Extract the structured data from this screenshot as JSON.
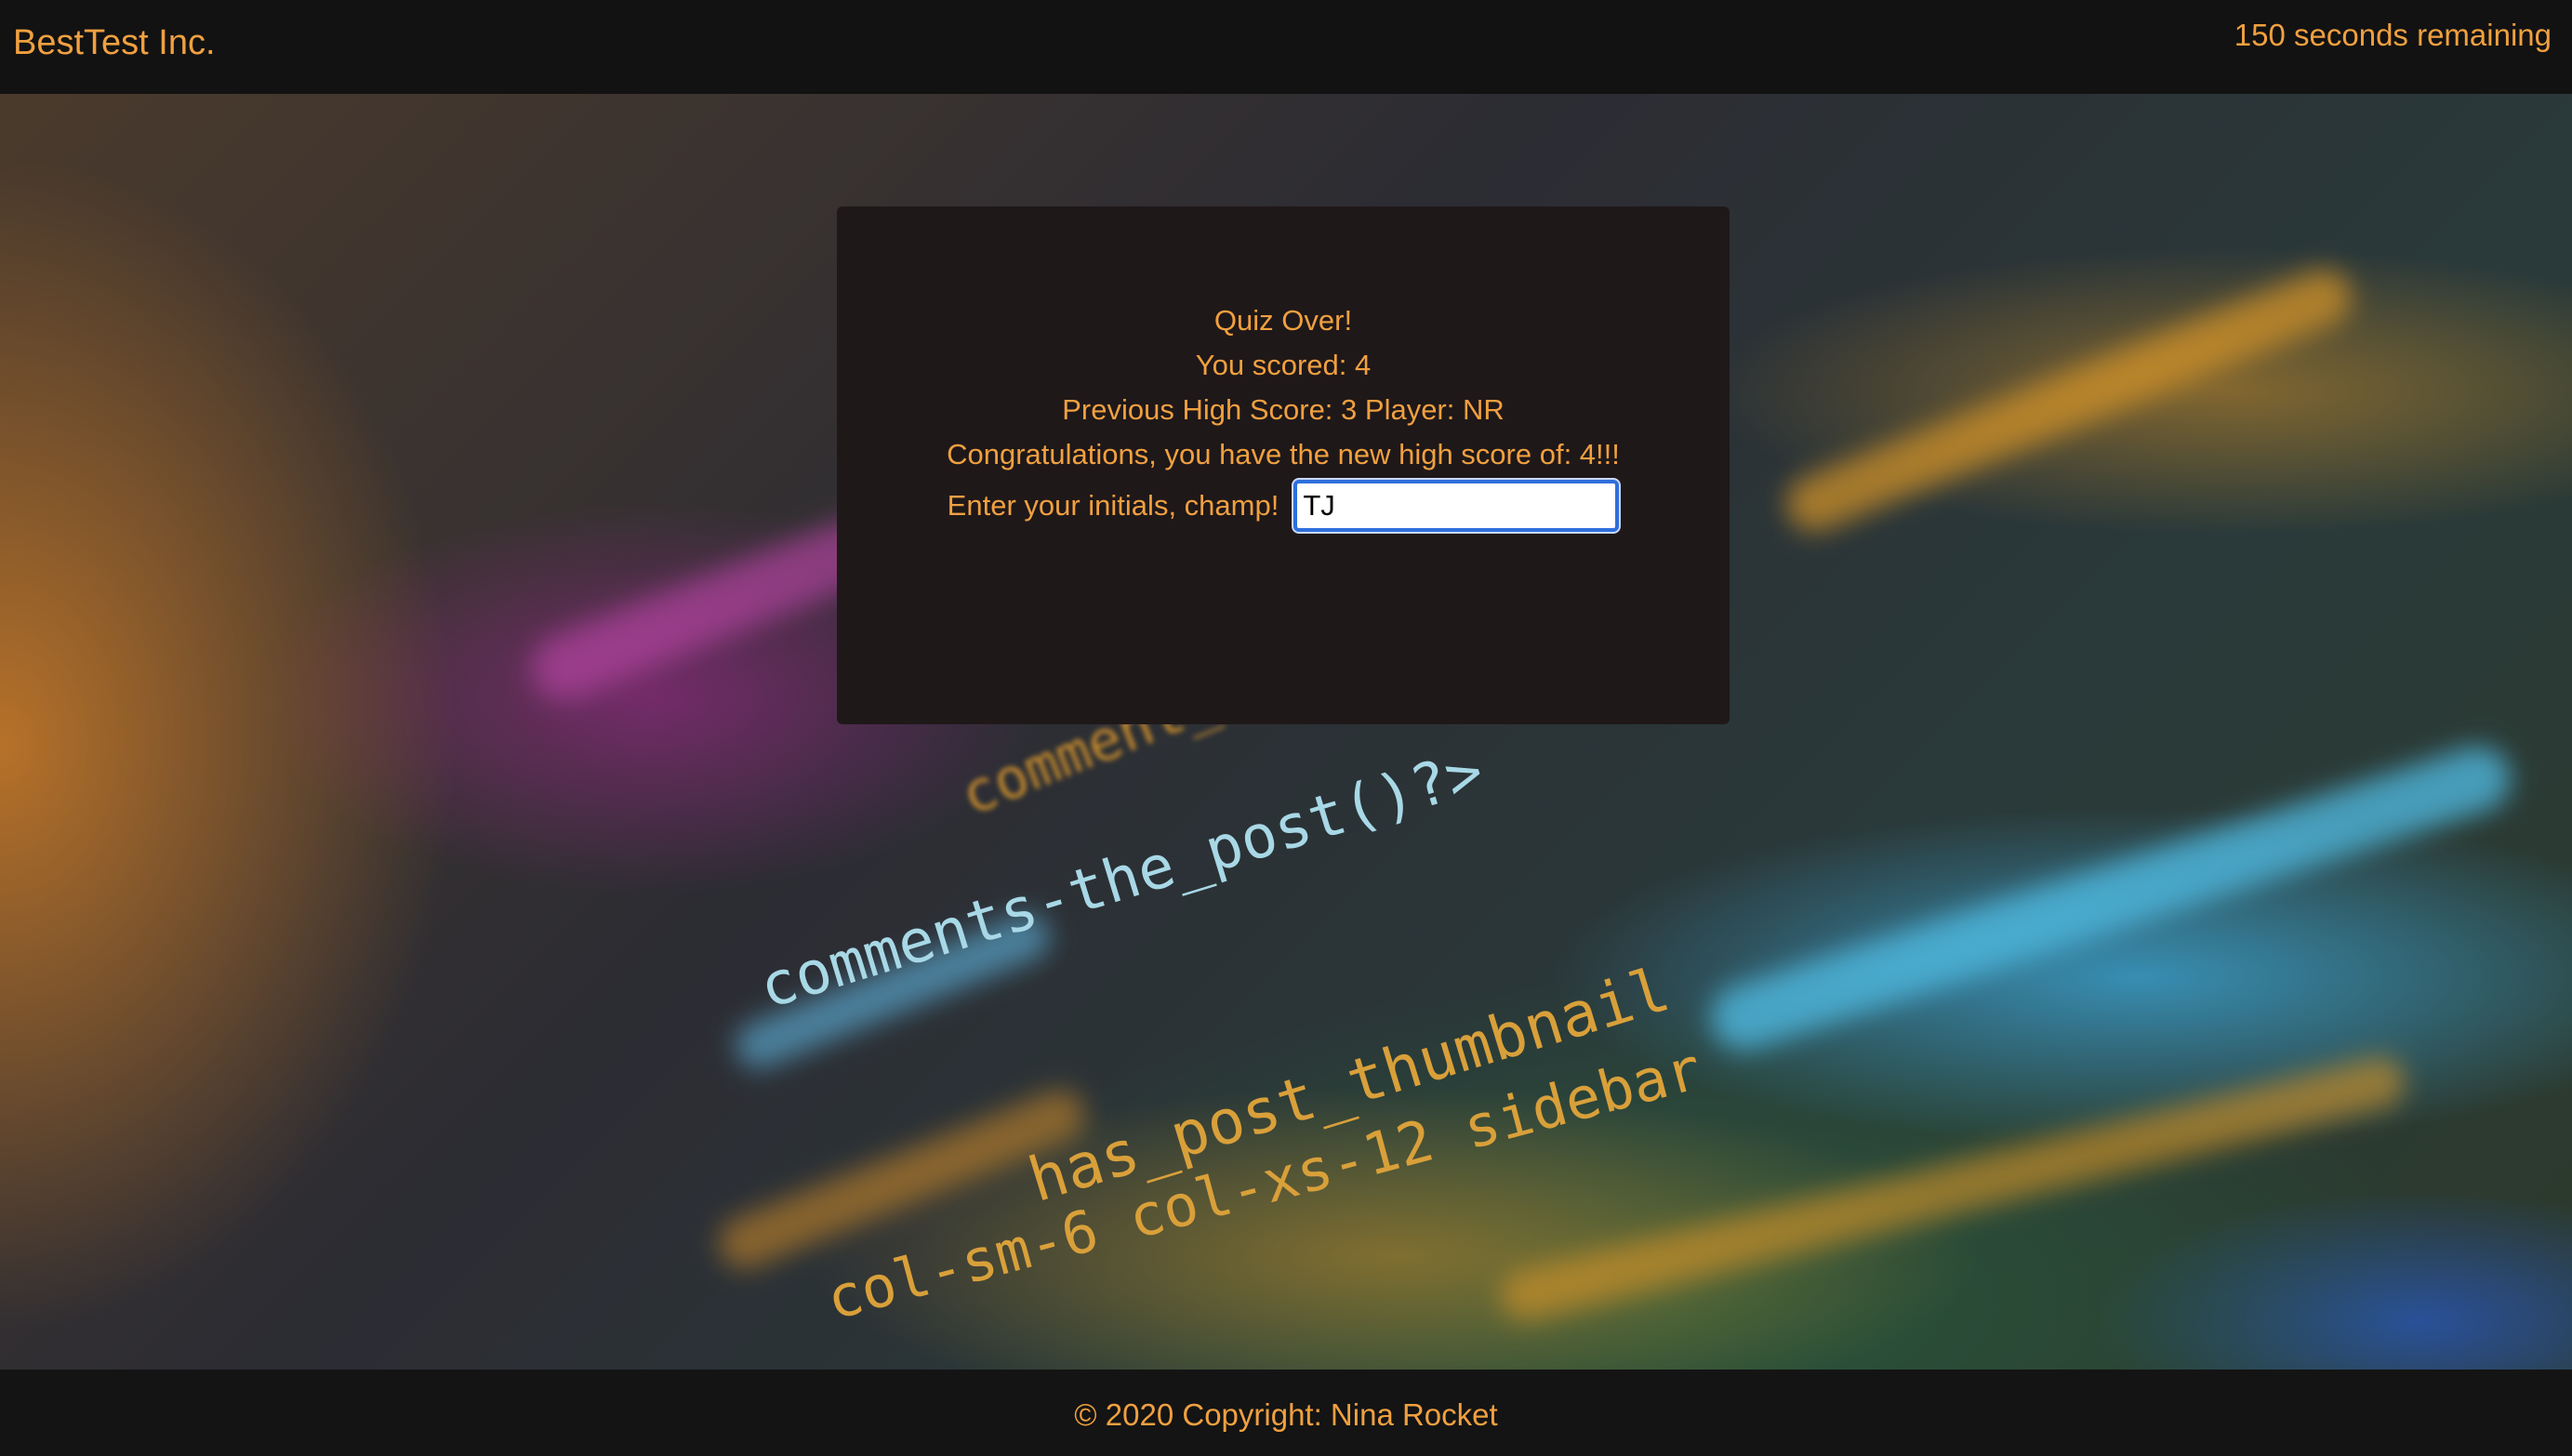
{
  "navbar": {
    "brand": "BestTest Inc.",
    "timer_text": "150 seconds remaining"
  },
  "background": {
    "code_lines": [
      "comment_count",
      "comments-the_post()?>",
      "has_post_thumbnail",
      "col-sm-6 col-xs-12 sidebar"
    ]
  },
  "quiz_result": {
    "title": "Quiz Over!",
    "score_text": "You scored: 4",
    "previous_high_score_text": "Previous High Score: 3 Player: NR",
    "congrats_text": "Congratulations, you have the new high score of: 4!!!",
    "initials_label": "Enter your initials, champ!",
    "initials_value": "TJ",
    "initials_placeholder": ""
  },
  "footer": {
    "copyright": "© 2020 Copyright: Nina Rocket"
  },
  "colors": {
    "accent": "#f0a040",
    "modal_bg": "#1f1819",
    "nav_bg": "#121212",
    "input_focus": "#2f6fdc"
  }
}
